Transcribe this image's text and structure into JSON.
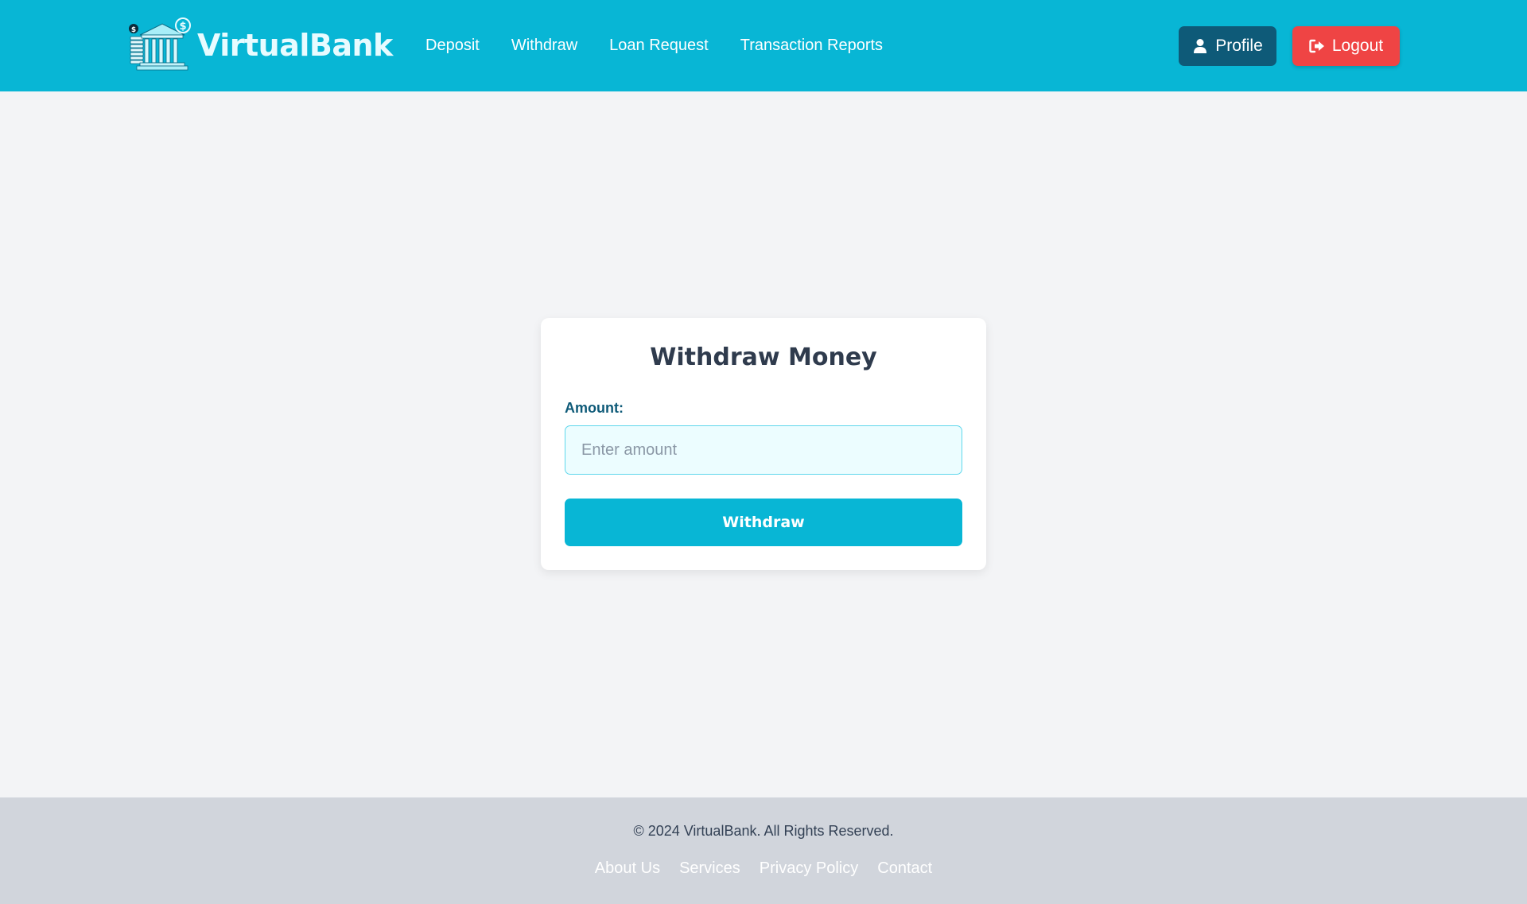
{
  "header": {
    "brand_name": "VirtualBank",
    "nav": [
      {
        "label": "Deposit"
      },
      {
        "label": "Withdraw"
      },
      {
        "label": "Loan Request"
      },
      {
        "label": "Transaction Reports"
      }
    ],
    "profile_label": "Profile",
    "logout_label": "Logout"
  },
  "withdraw_card": {
    "title": "Withdraw Money",
    "amount_label": "Amount:",
    "amount_placeholder": "Enter amount",
    "amount_value": "",
    "submit_label": "Withdraw"
  },
  "footer": {
    "copyright": "© 2024 VirtualBank. All Rights Reserved.",
    "links": [
      {
        "label": "About Us"
      },
      {
        "label": "Services"
      },
      {
        "label": "Privacy Policy"
      },
      {
        "label": "Contact"
      }
    ]
  },
  "colors": {
    "primary": "#08b6d5",
    "profile_button": "#0e5a78",
    "logout_button": "#ef4444",
    "page_background": "#f3f4f6",
    "footer_background": "#d1d5dc"
  },
  "icons": {
    "logo": "bank-building-logo-icon",
    "profile": "user-icon",
    "logout": "sign-out-icon"
  }
}
